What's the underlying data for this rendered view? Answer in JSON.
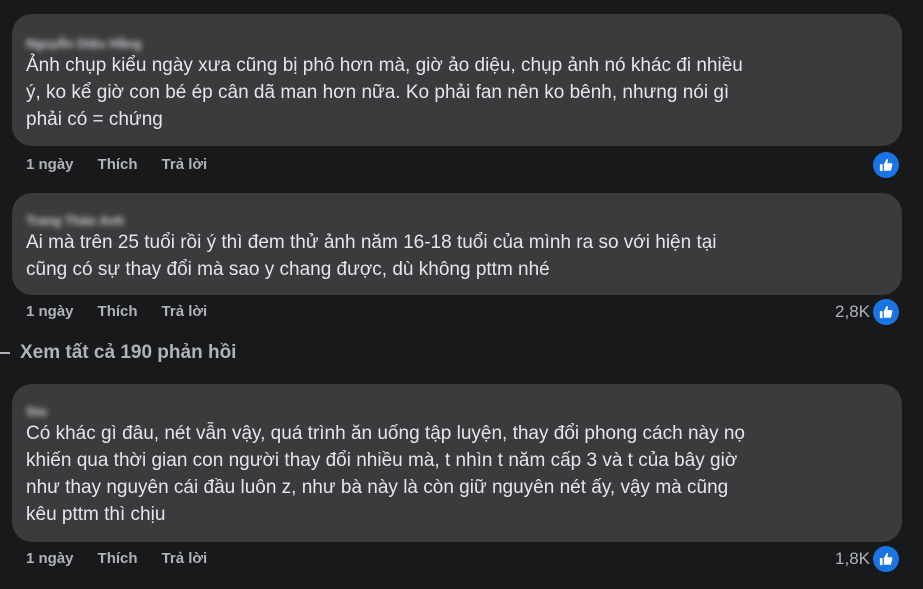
{
  "comments": [
    {
      "author": "Nguyễn Diệu Hằng",
      "text": "Ảnh chụp kiểu ngày xưa cũng bị phô hơn mà, giờ ảo diệu, chụp ảnh nó khác đi nhiều\ný, ko kể giờ con bé ép cân dã man hơn nữa. Ko phải fan nên ko bênh, nhưng nói gì\nphải có = chứng",
      "time": "1 ngày",
      "like_label": "Thích",
      "reply_label": "Trả lời",
      "reaction_count": ""
    },
    {
      "author": "Trang Thảo Anh",
      "text": "Ai mà trên 25 tuổi rồi ý thì đem thử ảnh năm 16-18 tuổi của mình ra so với hiện tại\ncũng có sự thay đổi mà sao y chang được, dù không pttm nhé",
      "time": "1 ngày",
      "like_label": "Thích",
      "reply_label": "Trả lời",
      "reaction_count": "2,8K"
    },
    {
      "author": "Sto",
      "text": "Có khác gì đâu, nét vẫn vậy, quá trình ăn uống tập luyện, thay đổi phong cách này nọ\nkhiến qua thời gian con người thay đổi nhiều mà, t nhìn t năm cấp 3 và t của bây giờ\nnhư thay nguyên cái đầu luôn z, như bà này là còn giữ nguyên nét ấy, vậy mà cũng\nkêu pttm thì chịu",
      "time": "1 ngày",
      "like_label": "Thích",
      "reply_label": "Trả lời",
      "reaction_count": "1,8K"
    }
  ],
  "view_replies": "Xem tất cả 190 phản hồi",
  "icons": {
    "reaction": "like-thumbs-up-icon",
    "accent": "#1b74e4"
  }
}
